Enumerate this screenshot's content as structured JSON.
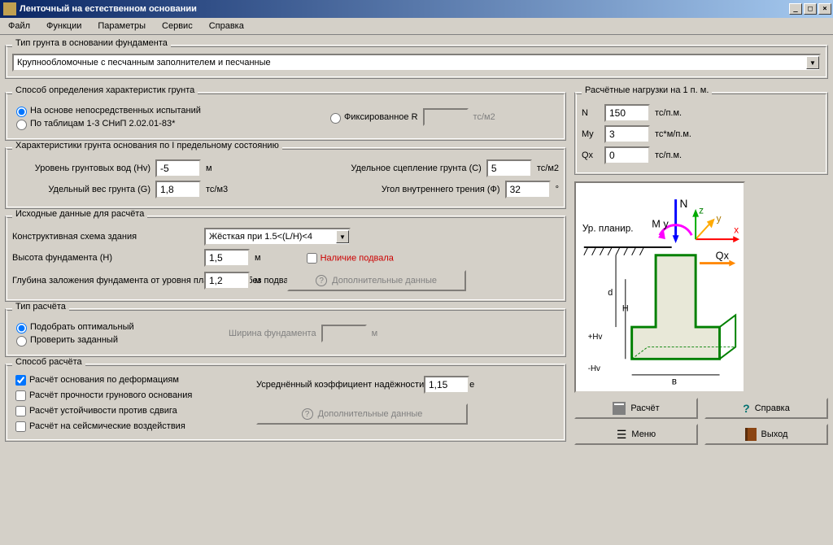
{
  "window": {
    "title": "Ленточный на естественном основании"
  },
  "menu": {
    "file": "Файл",
    "functions": "Функции",
    "params": "Параметры",
    "service": "Сервис",
    "help": "Справка"
  },
  "soil_type": {
    "legend": "Тип грунта в основании фундамента",
    "value": "Крупнообломочные с песчанным заполнителем и песчанные"
  },
  "determ": {
    "legend": "Способ определения характеристик грунта",
    "opt1": "На основе непосредственных испытаний",
    "opt2": "По таблицам 1-3 СНиП 2.02.01-83*",
    "opt3": "Фиксированное R",
    "unit": "тс/м2"
  },
  "soil_char": {
    "legend": "Характеристики грунта основания по I предельному состоянию",
    "hv_label": "Уровень грунтовых вод (Hv)",
    "hv": "-5",
    "hv_unit": "м",
    "g_label": "Удельный вес грунта (G)",
    "g": "1,8",
    "g_unit": "тс/м3",
    "c_label": "Удельное сцепление грунта (C)",
    "c": "5",
    "c_unit": "тс/м2",
    "phi_label": "Угол внутреннего трения (Ф)",
    "phi": "32",
    "phi_unit": "°"
  },
  "init": {
    "legend": "Исходные данные для расчёта",
    "scheme_label": "Конструктивная схема здания",
    "scheme": "Жёсткая при 1.5<(L/H)<4",
    "basement": "Наличие подвала",
    "h_label": "Высота фундамента (H)",
    "h": "1,5",
    "h_unit": "м",
    "d_label": "Глубина заложения фундамента от уровня планировки (без подвала) (d)",
    "d": "1,2",
    "d_unit": "м",
    "more": "Дополнительные данные"
  },
  "calc_type": {
    "legend": "Тип расчёта",
    "opt1": "Подобрать оптимальный",
    "opt2": "Проверить заданный",
    "width_label": "Ширина фундамента",
    "width_unit": "м"
  },
  "calc_method": {
    "legend": "Способ расчёта",
    "c1": "Расчёт основания по деформациям",
    "c2": "Расчёт прочности грунового основания",
    "c3": "Расчёт устойчивости против сдвига",
    "c4": "Расчёт на сейсмические воздействия",
    "coef_label": "Усреднённый коэффициент надёжности по нагрузке",
    "coef": "1,15",
    "more": "Дополнительные данные"
  },
  "loads": {
    "legend": "Расчётные нагрузки на 1 п. м.",
    "n_label": "N",
    "n": "150",
    "n_unit": "тс/п.м.",
    "my_label": "My",
    "my": "3",
    "my_unit": "тс*м/п.м.",
    "qx_label": "Qx",
    "qx": "0",
    "qx_unit": "тс/п.м."
  },
  "diagram_labels": {
    "level": "Ур. планир.",
    "n": "N",
    "my": "M y",
    "qx": "Qx",
    "x": "x",
    "y": "y",
    "z": "z",
    "b": "в",
    "h": "H",
    "hv_plus": "+Hv",
    "hv_minus": "-Hv",
    "d": "d"
  },
  "buttons": {
    "calc": "Расчёт",
    "help": "Справка",
    "menu": "Меню",
    "exit": "Выход"
  }
}
